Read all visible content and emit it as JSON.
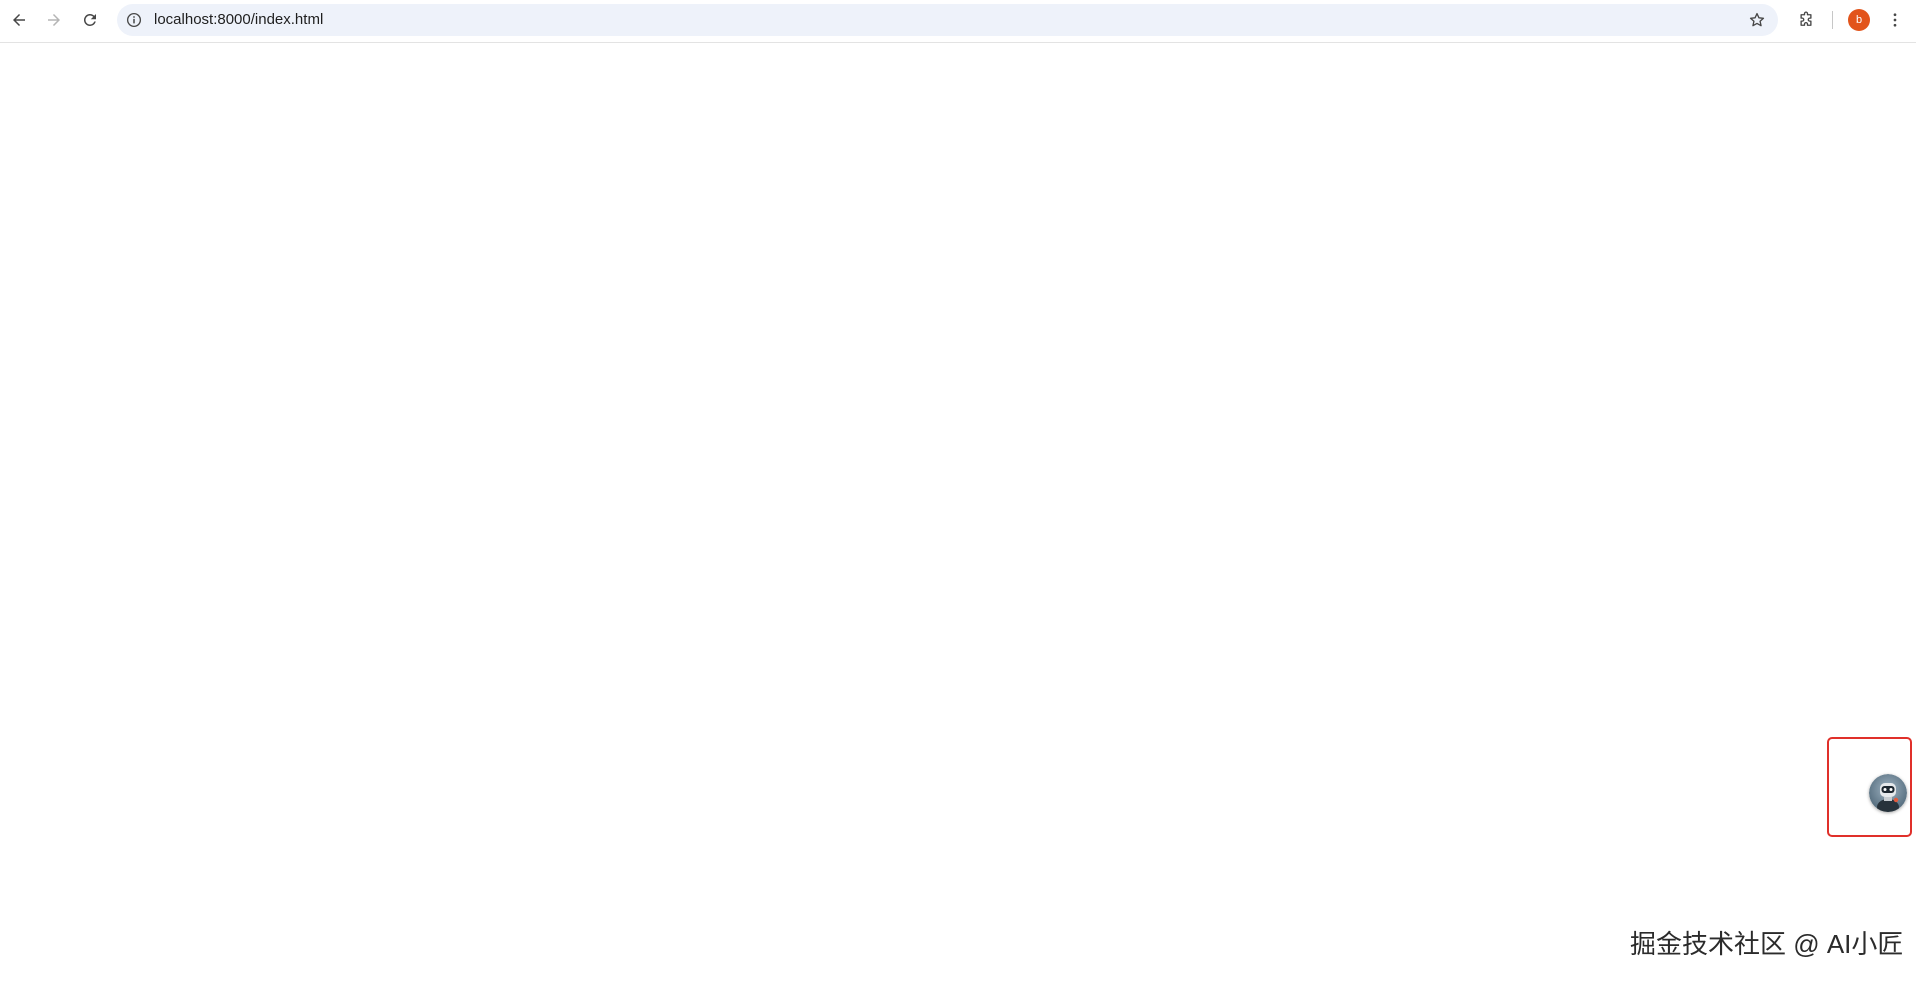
{
  "browser": {
    "url": "localhost:8000/index.html",
    "profile_initial": "b",
    "icons": {
      "back": "arrow-left-icon",
      "forward": "arrow-right-icon",
      "reload": "reload-icon",
      "site_info": "info-icon",
      "bookmark": "star-icon",
      "extensions": "puzzle-icon",
      "menu": "kebab-menu-icon"
    },
    "colors": {
      "omnibox_bg": "#eef2fa",
      "profile_bg": "#e2541b"
    }
  },
  "page": {
    "floating_button": {
      "icon": "chat-avatar-icon",
      "highlight_color": "#e0302a"
    },
    "watermark": "掘金技术社区 @ AI小匠"
  }
}
